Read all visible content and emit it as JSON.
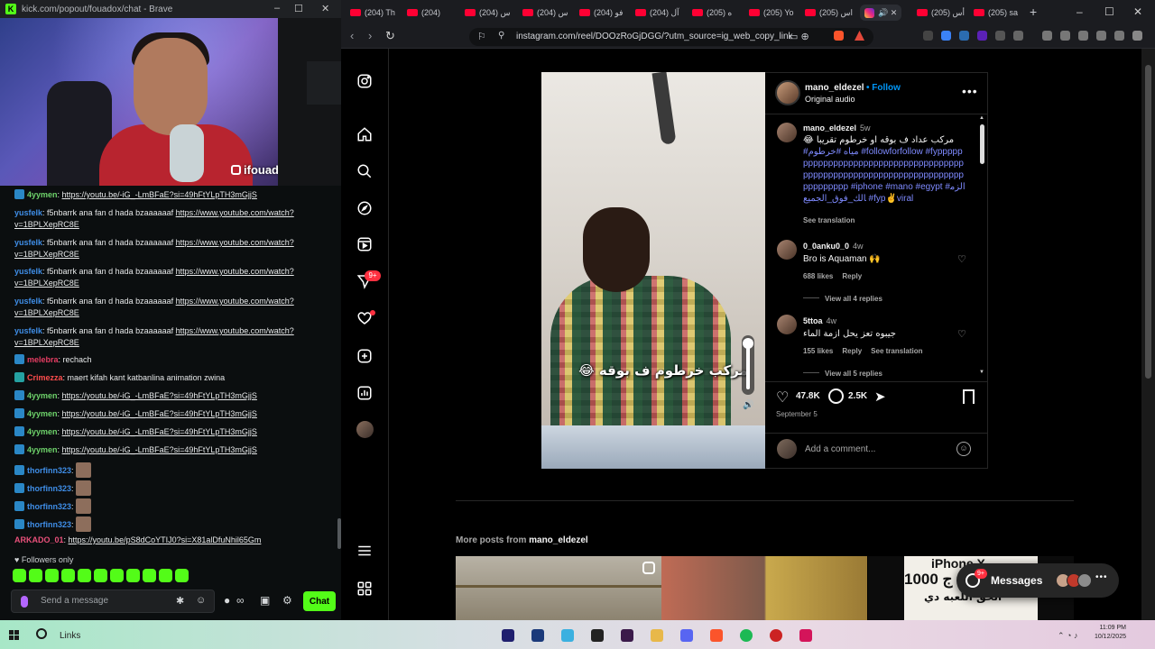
{
  "kick_window": {
    "title": "kick.com/popout/fouadox/chat - Brave",
    "webcam_name": "ifouadox",
    "messages": [
      {
        "user": "4yymen",
        "user_color": "#6ed36b",
        "text": "",
        "link": "https://youtu.be/-iG_-LmBFaE?si=49hFtYLpTH3mGjjS",
        "badge": true
      },
      {
        "user": "yusfelk",
        "user_color": "#3f8ee8",
        "text": "f5nbarrk ana fan d hada bzaaaaaaf ",
        "link": "https://www.youtube.com/watch?v=1BPLXepRC8E",
        "badge": false
      },
      {
        "user": "yusfelk",
        "user_color": "#3f8ee8",
        "text": "f5nbarrk ana fan d hada bzaaaaaaf ",
        "link": "https://www.youtube.com/watch?v=1BPLXepRC8E",
        "badge": false
      },
      {
        "user": "yusfelk",
        "user_color": "#3f8ee8",
        "text": "f5nbarrk ana fan d hada bzaaaaaaf ",
        "link": "https://www.youtube.com/watch?v=1BPLXepRC8E",
        "badge": false
      },
      {
        "user": "yusfelk",
        "user_color": "#3f8ee8",
        "text": "f5nbarrk ana fan d hada bzaaaaaaf ",
        "link": "https://www.youtube.com/watch?v=1BPLXepRC8E",
        "badge": false
      },
      {
        "user": "yusfelk",
        "user_color": "#3f8ee8",
        "text": "f5nbarrk ana fan d hada bzaaaaaaf ",
        "link": "https://www.youtube.com/watch?v=1BPLXepRC8E",
        "badge": false
      },
      {
        "user": "melebra",
        "user_color": "#e63d63",
        "text": "rechach",
        "link": "",
        "badge": true
      },
      {
        "user": "Crimezza",
        "user_color": "#ff4d4d",
        "text": "maert kifah kant katbanlina animation zwina",
        "link": "",
        "badge": true
      },
      {
        "user": "4yymen",
        "user_color": "#6ed36b",
        "text": "",
        "link": "https://youtu.be/-iG_-LmBFaE?si=49hFtYLpTH3mGjjS",
        "badge": true
      },
      {
        "user": "4yymen",
        "user_color": "#6ed36b",
        "text": "",
        "link": "https://youtu.be/-iG_-LmBFaE?si=49hFtYLpTH3mGjjS",
        "badge": true
      },
      {
        "user": "4yymen",
        "user_color": "#6ed36b",
        "text": "",
        "link": "https://youtu.be/-iG_-LmBFaE?si=49hFtYLpTH3mGjjS",
        "badge": true
      },
      {
        "user": "4yymen",
        "user_color": "#6ed36b",
        "text": "",
        "link": "https://youtu.be/-iG_-LmBFaE?si=49hFtYLpTH3mGjjS",
        "badge": true
      },
      {
        "user": "thorfinn323",
        "user_color": "#3f8ee8",
        "text": "",
        "link": "",
        "badge": true,
        "emote": true
      },
      {
        "user": "thorfinn323",
        "user_color": "#3f8ee8",
        "text": "",
        "link": "",
        "badge": true,
        "emote": true
      },
      {
        "user": "thorfinn323",
        "user_color": "#3f8ee8",
        "text": "",
        "link": "",
        "badge": true,
        "emote": true
      },
      {
        "user": "thorfinn323",
        "user_color": "#3f8ee8",
        "text": "",
        "link": "",
        "badge": true,
        "emote": true
      },
      {
        "user": "ARKADO_01",
        "user_color": "#e8507a",
        "text": "",
        "link": "https://youtu.be/pS8dCoYTIJ0?si=X81alDfuNhil65Gm",
        "badge": false
      }
    ],
    "followers_only": "Followers only",
    "composer_placeholder": "Send a message",
    "chat_button": "Chat"
  },
  "browser": {
    "tabs": [
      "(204) Th",
      "(204)",
      "(204) س",
      "(204) س",
      "(204) فو",
      "(204) آل",
      "(205) ه",
      "(205) Yo",
      "(205) اس",
      "",
      "(205) أس",
      "(205) sa"
    ],
    "new_tab": "+",
    "url": "instagram.com/reel/DOOzRoGjDGG/?utm_source=ig_web_copy_link"
  },
  "instagram": {
    "post": {
      "username": "mano_eldezel",
      "follow": "Follow",
      "audio": "Original audio",
      "caption_user": "mano_eldezel",
      "caption_time": "5w",
      "caption_text": "مركب عداد ف بوقه او خرطوم تقريبا 😂",
      "caption_tags": "#مياه #خرطوم #followforfollow #fypppppppppppppppppppppppppppppppppppppppppppppppppppppppppppppppppppppppppppppp #iphone #mano #egypt #الزمالك_فوق_الجميع #fyp✌️viral",
      "see_translation": "See translation",
      "reel_overlay_text": "مركب خرطوم ف بوقه 😂",
      "comments": [
        {
          "user": "0_0anku0_0",
          "time": "4w",
          "text": "Bro is Aquaman 🙌",
          "likes": "688 likes",
          "reply": "Reply",
          "translate": "",
          "replies": "View all 4 replies"
        },
        {
          "user": "5ttoa",
          "time": "4w",
          "text": "جيبوه تعز يحل ازمة الماء",
          "likes": "155 likes",
          "reply": "Reply",
          "translate": "See translation",
          "replies": "View all 5 replies"
        }
      ],
      "like_count": "47.8K",
      "comment_count": "2.5K",
      "date": "September 5",
      "add_comment_placeholder": "Add a comment..."
    },
    "more_posts_label": "More posts from",
    "more_posts_user": "mano_eldezel",
    "promo": {
      "title": "iPhone X",
      "price": "1000 ج",
      "sub": "الحق اللعبه دي"
    },
    "sidebar_badge": "9+",
    "messages": {
      "label": "Messages",
      "badge": "9+"
    }
  },
  "taskbar": {
    "search": "Links",
    "time": "11:09 PM",
    "date": "10/12/2025"
  },
  "colors": {
    "kick_green": "#53fc18",
    "ig_blue": "#0095f6",
    "ig_red": "#ff3040"
  }
}
